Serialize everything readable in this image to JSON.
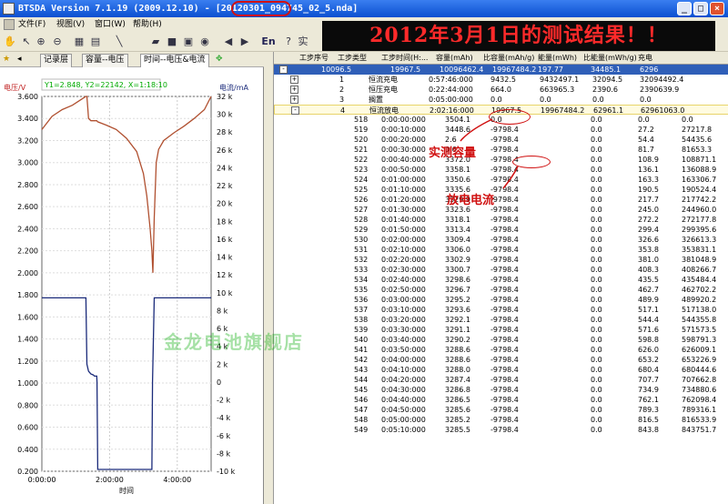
{
  "window": {
    "title_prefix": "BTSDA Version 7.1.19 (2009.12.10)  - [",
    "title_file_highlight": "20120301",
    "title_file_rest": "_094745_02_5.nda]",
    "minimize": "_",
    "maximize": "□",
    "close": "×"
  },
  "menu": [
    "文件(F)",
    "视图(V)",
    "窗口(W)",
    "帮助(H)"
  ],
  "toolbar": {
    "en_label": "En",
    "mode_label": "实"
  },
  "banner": "2012年3月1日的测试结果！！",
  "tabs": [
    "记录层",
    "容量--电压",
    "时间--电压&电流"
  ],
  "chart_data": {
    "type": "line",
    "readout": "Y1=2.848, Y2=22142, X=1:18:10",
    "y1_label": "电压/V",
    "y2_label": "电流/mA",
    "x_label": "时间",
    "y1_ticks": [
      "3.600",
      "3.400",
      "3.200",
      "3.000",
      "2.800",
      "2.600",
      "2.400",
      "2.200",
      "2.000",
      "1.800",
      "1.600",
      "1.400",
      "1.200",
      "1.000",
      "0.800",
      "0.600",
      "0.400",
      "0.200"
    ],
    "y2_ticks": [
      "32 k",
      "30 k",
      "28 k",
      "26 k",
      "24 k",
      "22 k",
      "20 k",
      "18 k",
      "16 k",
      "14 k",
      "12 k",
      "10 k",
      "8 k",
      "6 k",
      "4 k",
      "2 k",
      "0",
      "-2 k",
      "-4 k",
      "-6 k",
      "-8 k",
      "-10 k"
    ],
    "x_ticks": [
      "0:00:00",
      "2:00:00",
      "4:00:00"
    ],
    "y1lim": [
      0.2,
      3.6
    ],
    "y2lim": [
      -10000,
      32000
    ],
    "xlim_hours": [
      0,
      5.0
    ],
    "series": [
      {
        "axis": "y1",
        "color": "#b05030",
        "points": [
          [
            0,
            3.3
          ],
          [
            0.3,
            3.42
          ],
          [
            0.6,
            3.48
          ],
          [
            0.9,
            3.52
          ],
          [
            1.2,
            3.58
          ],
          [
            1.3,
            3.6
          ],
          [
            1.33,
            3.6
          ],
          [
            1.36,
            3.48
          ],
          [
            1.38,
            3.4
          ],
          [
            1.45,
            3.38
          ],
          [
            1.55,
            3.38
          ],
          [
            1.62,
            3.38
          ],
          [
            1.65,
            3.37
          ],
          [
            1.9,
            3.34
          ],
          [
            2.2,
            3.3
          ],
          [
            2.5,
            3.22
          ],
          [
            2.8,
            3.1
          ],
          [
            3.0,
            2.9
          ],
          [
            3.1,
            2.7
          ],
          [
            3.2,
            2.4
          ],
          [
            3.25,
            2.2
          ],
          [
            3.28,
            2.0
          ],
          [
            3.32,
            2.5
          ],
          [
            3.38,
            3.0
          ],
          [
            3.45,
            3.12
          ],
          [
            3.6,
            3.2
          ],
          [
            3.9,
            3.27
          ],
          [
            4.2,
            3.33
          ],
          [
            4.5,
            3.4
          ],
          [
            4.8,
            3.48
          ],
          [
            5.0,
            3.6
          ]
        ]
      },
      {
        "axis": "y2",
        "color": "#1a2a7a",
        "points": [
          [
            0,
            9432.5
          ],
          [
            1.3,
            9432.5
          ],
          [
            1.33,
            2000
          ],
          [
            1.38,
            1200
          ],
          [
            1.45,
            900
          ],
          [
            1.52,
            800
          ],
          [
            1.55,
            664
          ],
          [
            1.62,
            664
          ],
          [
            1.63,
            0
          ],
          [
            1.65,
            -9798.4
          ],
          [
            3.25,
            -9798.4
          ],
          [
            3.27,
            0
          ],
          [
            3.32,
            9432.5
          ],
          [
            5.0,
            9432.5
          ]
        ]
      }
    ]
  },
  "grid": {
    "columns": [
      "工步序号",
      "工步类型",
      "工步时间(H:...",
      "容量(mAh)",
      "比容量(mAh/g)",
      "能量(mWh)",
      "比能量(mWh/g)",
      "充电"
    ],
    "cycle_row": [
      "-",
      "10096.5",
      "19967.5",
      "10096462.4",
      "19967484.2",
      "197.77",
      "34485.1",
      "6296"
    ],
    "step_rows": [
      [
        "+",
        "1",
        "恒流充电",
        "0:57:46:000",
        "9432.5",
        "9432497.1",
        "32094.5",
        "32094492.4"
      ],
      [
        "+",
        "2",
        "恒压充电",
        "0:22:44:000",
        "664.0",
        "663965.3",
        "2390.6",
        "2390639.9"
      ],
      [
        "+",
        "3",
        "搁置",
        "0:05:00:000",
        "0.0",
        "0.0",
        "0.0",
        "0.0"
      ],
      [
        "-",
        "4",
        "恒流放电",
        "2:02:16:000",
        "19967.5",
        "19967484.2",
        "62961.1",
        "62961063.0"
      ]
    ],
    "records": [
      [
        "518",
        "0:00:00:000",
        "3504.1",
        "0.0",
        "0.0",
        "0.0",
        "0.0"
      ],
      [
        "519",
        "0:00:10:000",
        "3448.6",
        "-9798.4",
        "0.0",
        "27.2",
        "27217.8"
      ],
      [
        "520",
        "0:00:20:000",
        "2.6",
        "-9798.4",
        "0.0",
        "54.4",
        "54435.6"
      ],
      [
        "521",
        "0:00:30:000",
        "0.6",
        "-9798.4",
        "0.0",
        "81.7",
        "81653.3"
      ],
      [
        "522",
        "0:00:40:000",
        "3372.0",
        "-9798.4",
        "0.0",
        "108.9",
        "108871.1"
      ],
      [
        "523",
        "0:00:50:000",
        "3358.1",
        "-9798.4",
        "0.0",
        "136.1",
        "136088.9"
      ],
      [
        "524",
        "0:01:00:000",
        "3350.6",
        "-9798.4",
        "0.0",
        "163.3",
        "163306.7"
      ],
      [
        "525",
        "0:01:10:000",
        "3335.6",
        "-9798.4",
        "0.0",
        "190.5",
        "190524.4"
      ],
      [
        "526",
        "0:01:20:000",
        "3329.9",
        "-9798.4",
        "0.0",
        "217.7",
        "217742.2"
      ],
      [
        "527",
        "0:01:30:000",
        "3323.6",
        "-9798.4",
        "0.0",
        "245.0",
        "244960.0"
      ],
      [
        "528",
        "0:01:40:000",
        "3318.1",
        "-9798.4",
        "0.0",
        "272.2",
        "272177.8"
      ],
      [
        "529",
        "0:01:50:000",
        "3313.4",
        "-9798.4",
        "0.0",
        "299.4",
        "299395.6"
      ],
      [
        "530",
        "0:02:00:000",
        "3309.4",
        "-9798.4",
        "0.0",
        "326.6",
        "326613.3"
      ],
      [
        "531",
        "0:02:10:000",
        "3306.0",
        "-9798.4",
        "0.0",
        "353.8",
        "353831.1"
      ],
      [
        "532",
        "0:02:20:000",
        "3302.9",
        "-9798.4",
        "0.0",
        "381.0",
        "381048.9"
      ],
      [
        "533",
        "0:02:30:000",
        "3300.7",
        "-9798.4",
        "0.0",
        "408.3",
        "408266.7"
      ],
      [
        "534",
        "0:02:40:000",
        "3298.6",
        "-9798.4",
        "0.0",
        "435.5",
        "435484.4"
      ],
      [
        "535",
        "0:02:50:000",
        "3296.7",
        "-9798.4",
        "0.0",
        "462.7",
        "462702.2"
      ],
      [
        "536",
        "0:03:00:000",
        "3295.2",
        "-9798.4",
        "0.0",
        "489.9",
        "489920.2"
      ],
      [
        "537",
        "0:03:10:000",
        "3293.6",
        "-9798.4",
        "0.0",
        "517.1",
        "517138.0"
      ],
      [
        "538",
        "0:03:20:000",
        "3292.1",
        "-9798.4",
        "0.0",
        "544.4",
        "544355.8"
      ],
      [
        "539",
        "0:03:30:000",
        "3291.1",
        "-9798.4",
        "0.0",
        "571.6",
        "571573.5"
      ],
      [
        "540",
        "0:03:40:000",
        "3290.2",
        "-9798.4",
        "0.0",
        "598.8",
        "598791.3"
      ],
      [
        "541",
        "0:03:50:000",
        "3288.6",
        "-9798.4",
        "0.0",
        "626.0",
        "626009.1"
      ],
      [
        "542",
        "0:04:00:000",
        "3288.6",
        "-9798.4",
        "0.0",
        "653.2",
        "653226.9"
      ],
      [
        "543",
        "0:04:10:000",
        "3288.0",
        "-9798.4",
        "0.0",
        "680.4",
        "680444.6"
      ],
      [
        "544",
        "0:04:20:000",
        "3287.4",
        "-9798.4",
        "0.0",
        "707.7",
        "707662.8"
      ],
      [
        "545",
        "0:04:30:000",
        "3286.8",
        "-9798.4",
        "0.0",
        "734.9",
        "734880.6"
      ],
      [
        "546",
        "0:04:40:000",
        "3286.5",
        "-9798.4",
        "0.0",
        "762.1",
        "762098.4"
      ],
      [
        "547",
        "0:04:50:000",
        "3285.6",
        "-9798.4",
        "0.0",
        "789.3",
        "789316.1"
      ],
      [
        "548",
        "0:05:00:000",
        "3285.2",
        "-9798.4",
        "0.0",
        "816.5",
        "816533.9"
      ],
      [
        "549",
        "0:05:10:000",
        "3285.5",
        "-9798.4",
        "0.0",
        "843.8",
        "843751.7"
      ]
    ]
  },
  "annotations": {
    "capacity": "实测容量",
    "current": "放电电流"
  },
  "watermark": "金龙电池旗舰店"
}
